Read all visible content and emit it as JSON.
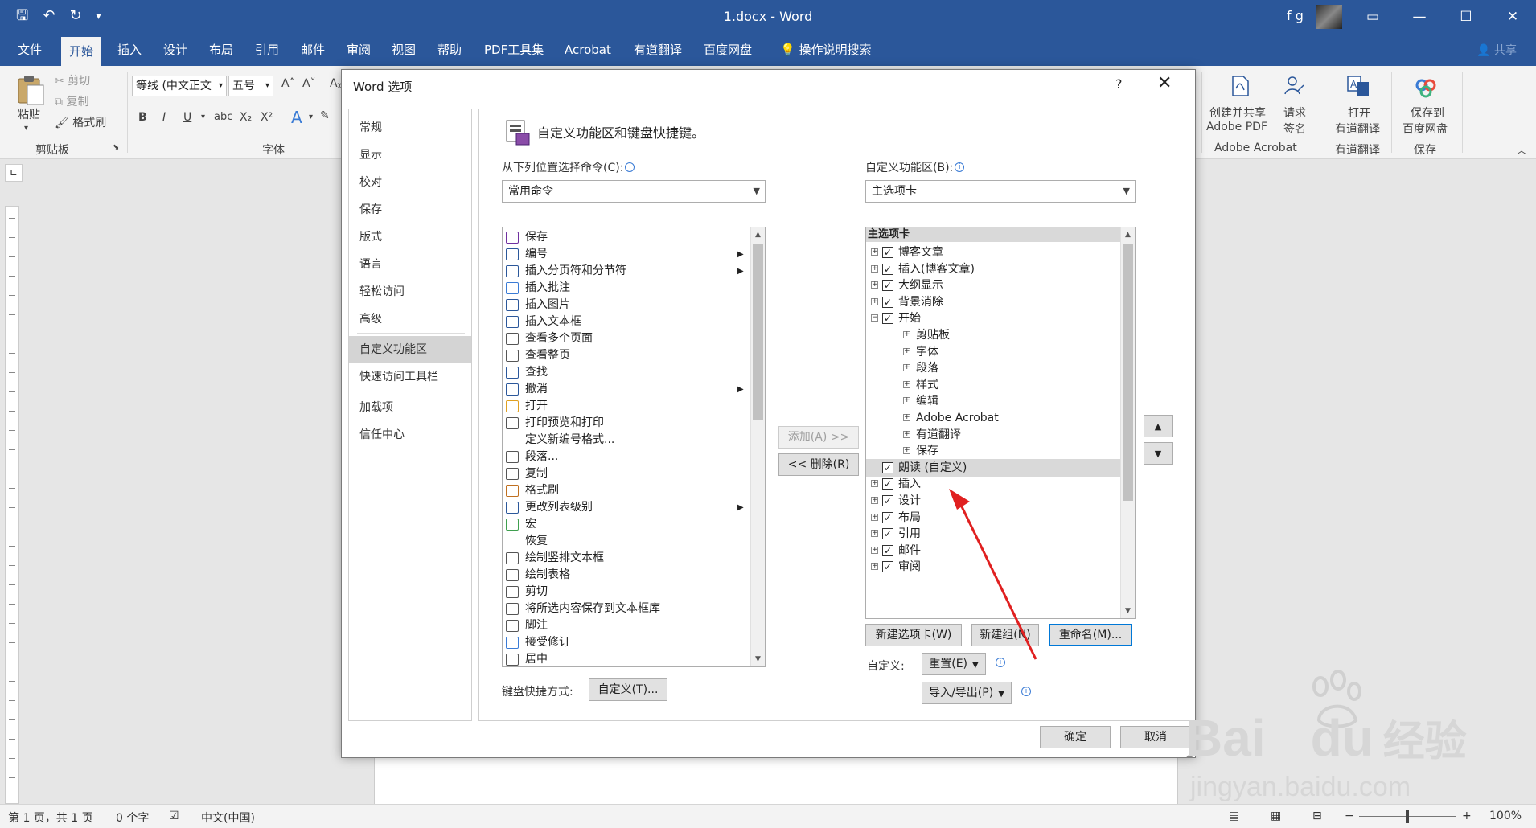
{
  "window": {
    "title": "1.docx  -  Word",
    "user": "f g",
    "share": "共享"
  },
  "ribbon_tabs": [
    "文件",
    "开始",
    "插入",
    "设计",
    "布局",
    "引用",
    "邮件",
    "审阅",
    "视图",
    "帮助",
    "PDF工具集",
    "Acrobat",
    "有道翻译",
    "百度网盘",
    "操作说明搜索"
  ],
  "ribbon": {
    "clipboard": {
      "paste": "粘贴",
      "cut": "剪切",
      "copy": "复制",
      "format_painter": "格式刷",
      "group": "剪贴板"
    },
    "font": {
      "name": "等线 (中文正文",
      "size": "五号",
      "group": "字体",
      "bold": "B",
      "italic": "I",
      "underline": "U",
      "strike": "abc",
      "sub": "X₂",
      "sup": "X²",
      "grow": "A˄",
      "shrink": "A˅",
      "text_effect": "A"
    },
    "acrobat": {
      "create_share": "创建并共享",
      "create_share_2": "Adobe PDF",
      "request_sign": "请求",
      "request_sign_2": "签名",
      "group": "Adobe Acrobat"
    },
    "youdao": {
      "open": "打开",
      "open_2": "有道翻译",
      "group": "有道翻译"
    },
    "baidu": {
      "save": "保存到",
      "save_2": "百度网盘",
      "group": "保存"
    }
  },
  "dialog": {
    "title": "Word 选项",
    "help": "?",
    "close": "✕",
    "nav": [
      "常规",
      "显示",
      "校对",
      "保存",
      "版式",
      "语言",
      "轻松访问",
      "高级",
      "自定义功能区",
      "快速访问工具栏",
      "加载项",
      "信任中心"
    ],
    "selected_nav": "自定义功能区",
    "heading": "自定义功能区和键盘快捷键。",
    "choose_label": "从下列位置选择命令(C):",
    "choose_value": "常用命令",
    "customize_label": "自定义功能区(B):",
    "customize_value": "主选项卡",
    "commands": [
      {
        "label": "保存",
        "icon": "save-icon",
        "arrow": false
      },
      {
        "label": "编号",
        "icon": "numbering-icon",
        "arrow": true
      },
      {
        "label": "插入分页符和分节符",
        "icon": "page-break-icon",
        "arrow": true
      },
      {
        "label": "插入批注",
        "icon": "comment-icon",
        "arrow": false
      },
      {
        "label": "插入图片",
        "icon": "picture-icon",
        "arrow": false
      },
      {
        "label": "插入文本框",
        "icon": "textbox-icon",
        "arrow": false
      },
      {
        "label": "查看多个页面",
        "icon": "multi-page-icon",
        "arrow": false
      },
      {
        "label": "查看整页",
        "icon": "one-page-icon",
        "arrow": false
      },
      {
        "label": "查找",
        "icon": "find-icon",
        "arrow": false
      },
      {
        "label": "撤消",
        "icon": "undo-icon",
        "arrow": true
      },
      {
        "label": "打开",
        "icon": "open-folder-icon",
        "arrow": false
      },
      {
        "label": "打印预览和打印",
        "icon": "print-preview-icon",
        "arrow": false
      },
      {
        "label": "定义新编号格式...",
        "icon": "",
        "arrow": false
      },
      {
        "label": "段落...",
        "icon": "paragraph-icon",
        "arrow": false
      },
      {
        "label": "复制",
        "icon": "copy-icon",
        "arrow": false
      },
      {
        "label": "格式刷",
        "icon": "format-painter-icon",
        "arrow": false
      },
      {
        "label": "更改列表级别",
        "icon": "list-level-icon",
        "arrow": true
      },
      {
        "label": "宏",
        "icon": "macro-icon",
        "arrow": false
      },
      {
        "label": "恢复",
        "icon": "",
        "arrow": false
      },
      {
        "label": "绘制竖排文本框",
        "icon": "vertical-textbox-icon",
        "arrow": false
      },
      {
        "label": "绘制表格",
        "icon": "draw-table-icon",
        "arrow": false
      },
      {
        "label": "剪切",
        "icon": "cut-icon",
        "arrow": false
      },
      {
        "label": "将所选内容保存到文本框库",
        "icon": "save-textbox-icon",
        "arrow": false
      },
      {
        "label": "脚注",
        "icon": "footnote-icon",
        "arrow": false
      },
      {
        "label": "接受修订",
        "icon": "accept-icon",
        "arrow": false
      },
      {
        "label": "居中",
        "icon": "center-icon",
        "arrow": false
      }
    ],
    "tree_header": "主选项卡",
    "tree": [
      {
        "label": "博客文章",
        "level": 0,
        "checkbox": true,
        "expander": "+"
      },
      {
        "label": "插入(博客文章)",
        "level": 0,
        "checkbox": true,
        "expander": "+"
      },
      {
        "label": "大纲显示",
        "level": 0,
        "checkbox": true,
        "expander": "+"
      },
      {
        "label": "背景消除",
        "level": 0,
        "checkbox": true,
        "expander": "+"
      },
      {
        "label": "开始",
        "level": 0,
        "checkbox": true,
        "expander": "−"
      },
      {
        "label": "剪贴板",
        "level": 1,
        "checkbox": false,
        "expander": "+"
      },
      {
        "label": "字体",
        "level": 1,
        "checkbox": false,
        "expander": "+"
      },
      {
        "label": "段落",
        "level": 1,
        "checkbox": false,
        "expander": "+"
      },
      {
        "label": "样式",
        "level": 1,
        "checkbox": false,
        "expander": "+"
      },
      {
        "label": "编辑",
        "level": 1,
        "checkbox": false,
        "expander": "+"
      },
      {
        "label": "Adobe Acrobat",
        "level": 1,
        "checkbox": false,
        "expander": "+"
      },
      {
        "label": "有道翻译",
        "level": 1,
        "checkbox": false,
        "expander": "+"
      },
      {
        "label": "保存",
        "level": 1,
        "checkbox": false,
        "expander": "+"
      },
      {
        "label": "朗读 (自定义)",
        "level": 0,
        "checkbox": true,
        "expander": "",
        "selected": true
      },
      {
        "label": "插入",
        "level": 0,
        "checkbox": true,
        "expander": "+"
      },
      {
        "label": "设计",
        "level": 0,
        "checkbox": true,
        "expander": "+"
      },
      {
        "label": "布局",
        "level": 0,
        "checkbox": true,
        "expander": "+"
      },
      {
        "label": "引用",
        "level": 0,
        "checkbox": true,
        "expander": "+"
      },
      {
        "label": "邮件",
        "level": 0,
        "checkbox": true,
        "expander": "+"
      },
      {
        "label": "审阅",
        "level": 0,
        "checkbox": true,
        "expander": "+"
      }
    ],
    "add_btn": "添加(A) >>",
    "remove_btn": "<< 删除(R)",
    "new_tab_btn": "新建选项卡(W)",
    "new_group_btn": "新建组(N)",
    "rename_btn": "重命名(M)...",
    "customize_text": "自定义:",
    "reset_btn": "重置(E)",
    "import_export_btn": "导入/导出(P)",
    "keyboard_label": "键盘快捷方式:",
    "keyboard_btn": "自定义(T)...",
    "ok_btn": "确定",
    "cancel_btn": "取消"
  },
  "status": {
    "page": "第 1 页，共 1 页",
    "words": "0 个字",
    "lang": "中文(中国)",
    "zoom": "100%"
  },
  "watermark": {
    "brand": "Bai",
    "du": "du",
    "jingyan": "经验",
    "url": "jingyan.baidu.com"
  },
  "colors": {
    "word_blue": "#2b579a",
    "annotation_red": "#e02020",
    "focus_blue": "#0078d7"
  }
}
